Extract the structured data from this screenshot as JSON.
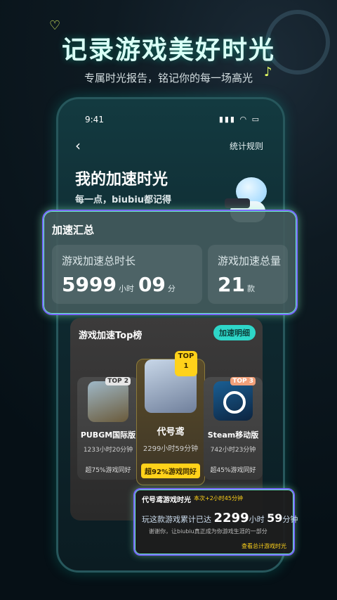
{
  "hero": {
    "title": "记录游戏美好时光",
    "subtitle": "专属时光报告，铭记你的每一场高光"
  },
  "phone": {
    "status_time": "9:41",
    "rules_link": "统计规则",
    "page_title": "我的加速时光",
    "page_subtitle": "每一点，biubiu都记得"
  },
  "summary": {
    "title": "加速汇总",
    "duration_label": "游戏加速总时长",
    "hours": "5999",
    "hours_unit": "小时",
    "minutes": "09",
    "minutes_unit": "分",
    "games_label": "游戏加速总量",
    "games_count": "21",
    "games_unit": "款"
  },
  "toplist": {
    "title": "游戏加速Top榜",
    "detail_button": "加速明细",
    "games": [
      {
        "rank_tag": "TOP 2",
        "name": "PUBGM国际版",
        "hours": "1233小时20分钟",
        "rank_text": "超75%游戏同好"
      },
      {
        "rank_tag": "TOP 1",
        "name": "代号鸢",
        "hours": "2299小时59分钟",
        "rank_text": "超92%游戏同好"
      },
      {
        "rank_tag": "TOP 3",
        "name": "Steam移动版",
        "hours": "742小时23分钟",
        "rank_text": "超45%游戏同好"
      }
    ]
  },
  "record": {
    "head": "代号鸢游戏时光",
    "sub": "本次+2小时45分钟",
    "line_prefix": "玩这款游戏累计已达",
    "hours": "2299",
    "hours_unit": "小时",
    "minutes": "59",
    "minutes_unit": "分钟",
    "quote": "谢谢你，让biubiu真正成为你游戏生涯的一部分",
    "link": "查看总计游戏时光"
  },
  "icons": [
    "heart-icon",
    "note-icon",
    "gamepad-icon",
    "back-icon",
    "signal-icon",
    "wifi-icon",
    "battery-icon",
    "pubg-icon",
    "daihaoyuan-icon",
    "steam-icon"
  ]
}
